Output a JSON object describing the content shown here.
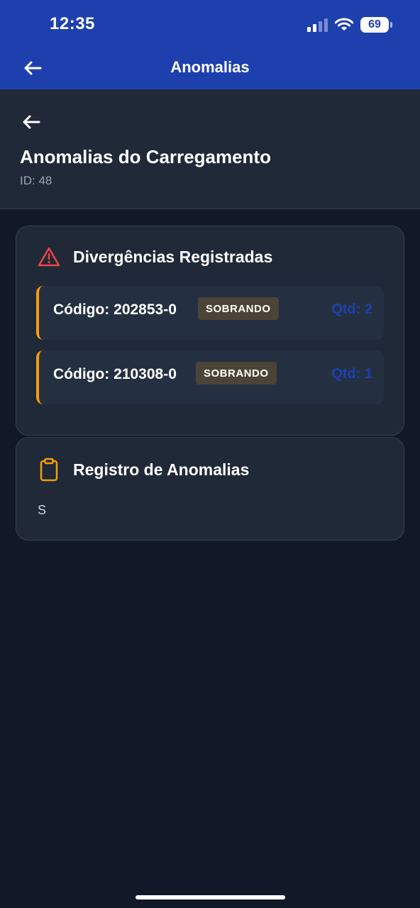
{
  "status_bar": {
    "time": "12:35",
    "battery": "69"
  },
  "app_bar": {
    "title": "Anomalias",
    "back_icon": "arrow-left-icon"
  },
  "header": {
    "title": "Anomalias do Carregamento",
    "subtitle": "ID: 48"
  },
  "divergences": {
    "heading": "Divergências Registradas",
    "icon": "warning-triangle-icon",
    "items": [
      {
        "code": "Código: 202853-0",
        "badge": "SOBRANDO",
        "qty": "Qtd: 2"
      },
      {
        "code": "Código: 210308-0",
        "badge": "SOBRANDO",
        "qty": "Qtd: 1"
      }
    ]
  },
  "registry": {
    "heading": "Registro de Anomalias",
    "icon": "clipboard-icon",
    "text": "S"
  },
  "colors": {
    "app_bar": "#1e40af",
    "background": "#111827",
    "card": "#1f2937",
    "accent_orange": "#f59e0b",
    "warning_red": "#ef4444",
    "qty_blue": "#1e40af"
  }
}
